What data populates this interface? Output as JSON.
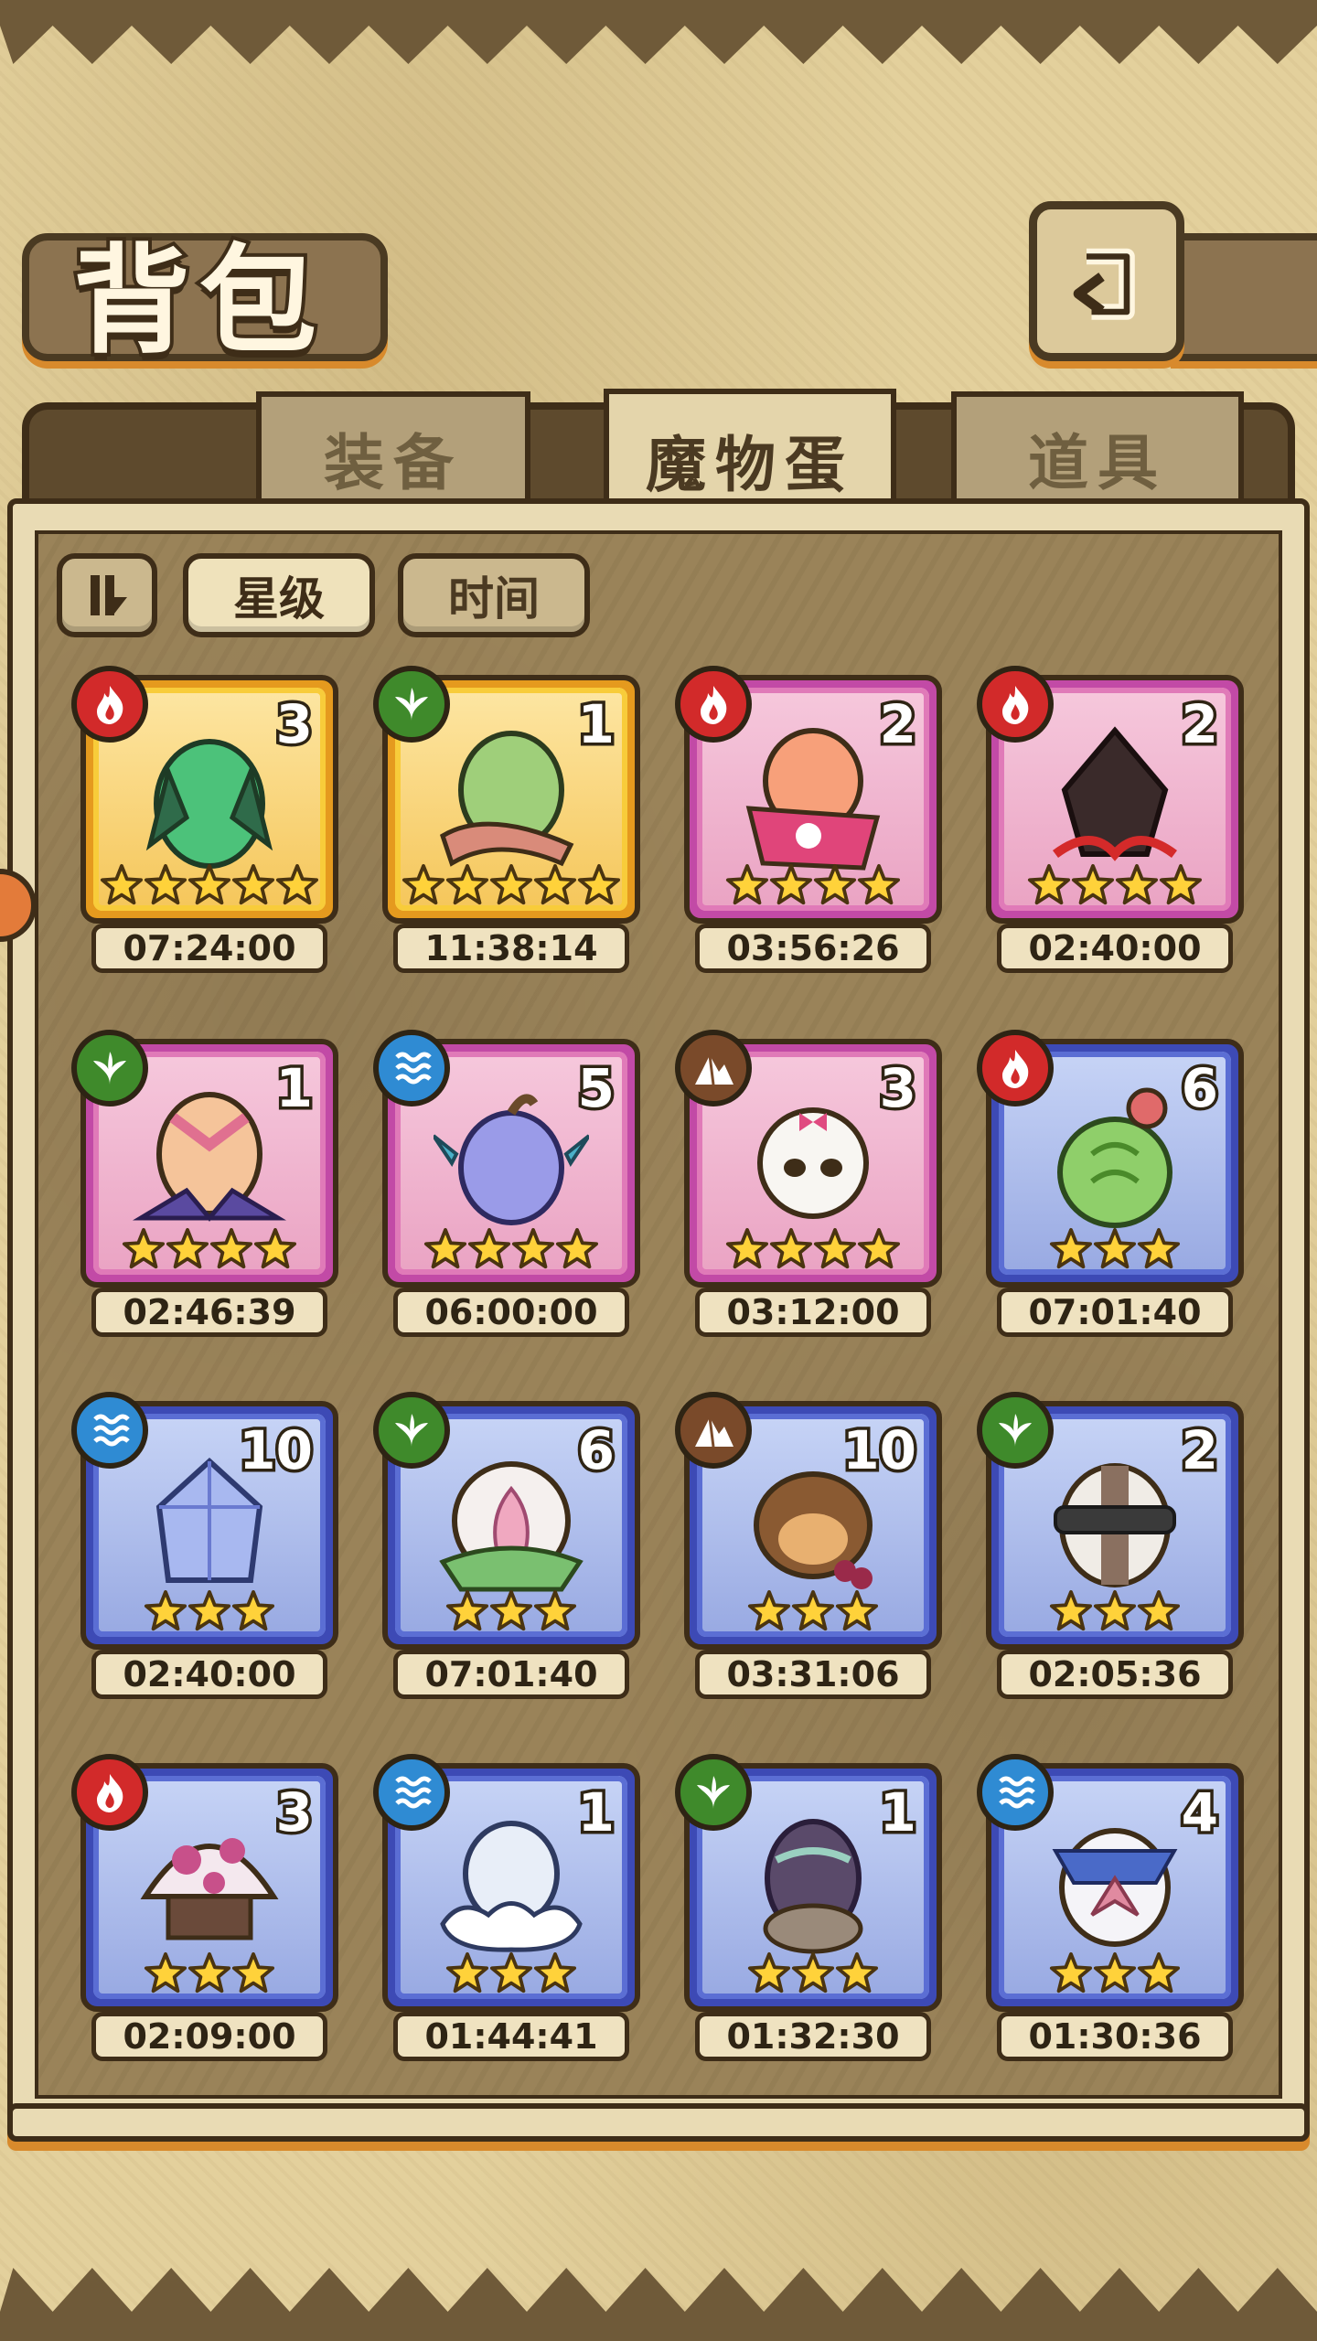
{
  "header": {
    "title": "背包",
    "back_icon": "back-arrow-icon"
  },
  "tabs": [
    {
      "label": "装备",
      "active": false
    },
    {
      "label": "魔物蛋",
      "active": true
    },
    {
      "label": "道具",
      "active": false
    }
  ],
  "filters": {
    "sort_icon": "sort-toggle-icon",
    "star_label": "星级",
    "time_label": "时间"
  },
  "colors": {
    "fire": "#d22a2a",
    "nature": "#3f8a2b",
    "water": "#2f8bd3",
    "earth": "#7a4a2a",
    "gold_frame": "#e59a1e",
    "pink_frame": "#c24aa6",
    "blue_frame": "#3d4ab5"
  },
  "eggs": [
    {
      "element": "fire",
      "frame": "gold",
      "count": "3",
      "stars": 5,
      "time": "07:24:00",
      "art": "green-dragon-egg"
    },
    {
      "element": "nature",
      "frame": "gold",
      "count": "1",
      "stars": 5,
      "time": "11:38:14",
      "art": "green-egg-scarf"
    },
    {
      "element": "fire",
      "frame": "pink",
      "count": "2",
      "stars": 4,
      "time": "03:56:26",
      "art": "kimono-egg"
    },
    {
      "element": "fire",
      "frame": "pink",
      "count": "2",
      "stars": 4,
      "time": "02:40:00",
      "art": "dark-flame-egg"
    },
    {
      "element": "nature",
      "frame": "pink",
      "count": "1",
      "stars": 4,
      "time": "02:46:39",
      "art": "feather-nest-egg"
    },
    {
      "element": "water",
      "frame": "pink",
      "count": "5",
      "stars": 4,
      "time": "06:00:00",
      "art": "fin-egg"
    },
    {
      "element": "earth",
      "frame": "pink",
      "count": "3",
      "stars": 4,
      "time": "03:12:00",
      "art": "skull-bow-egg"
    },
    {
      "element": "fire",
      "frame": "blue",
      "count": "6",
      "stars": 3,
      "time": "07:01:40",
      "art": "cactus-egg"
    },
    {
      "element": "water",
      "frame": "blue",
      "count": "10",
      "stars": 3,
      "time": "02:40:00",
      "art": "crystal-egg"
    },
    {
      "element": "nature",
      "frame": "blue",
      "count": "6",
      "stars": 3,
      "time": "07:01:40",
      "art": "lotus-egg"
    },
    {
      "element": "earth",
      "frame": "blue",
      "count": "10",
      "stars": 3,
      "time": "03:31:06",
      "art": "monkey-egg"
    },
    {
      "element": "nature",
      "frame": "blue",
      "count": "2",
      "stars": 3,
      "time": "02:05:36",
      "art": "studded-collar-egg"
    },
    {
      "element": "fire",
      "frame": "blue",
      "count": "3",
      "stars": 3,
      "time": "02:09:00",
      "art": "mushroom-egg"
    },
    {
      "element": "water",
      "frame": "blue",
      "count": "1",
      "stars": 3,
      "time": "01:44:41",
      "art": "cloud-egg"
    },
    {
      "element": "nature",
      "frame": "blue",
      "count": "1",
      "stars": 3,
      "time": "01:32:30",
      "art": "purple-fur-egg"
    },
    {
      "element": "water",
      "frame": "blue",
      "count": "4",
      "stars": 3,
      "time": "01:30:36",
      "art": "sailor-egg"
    }
  ]
}
